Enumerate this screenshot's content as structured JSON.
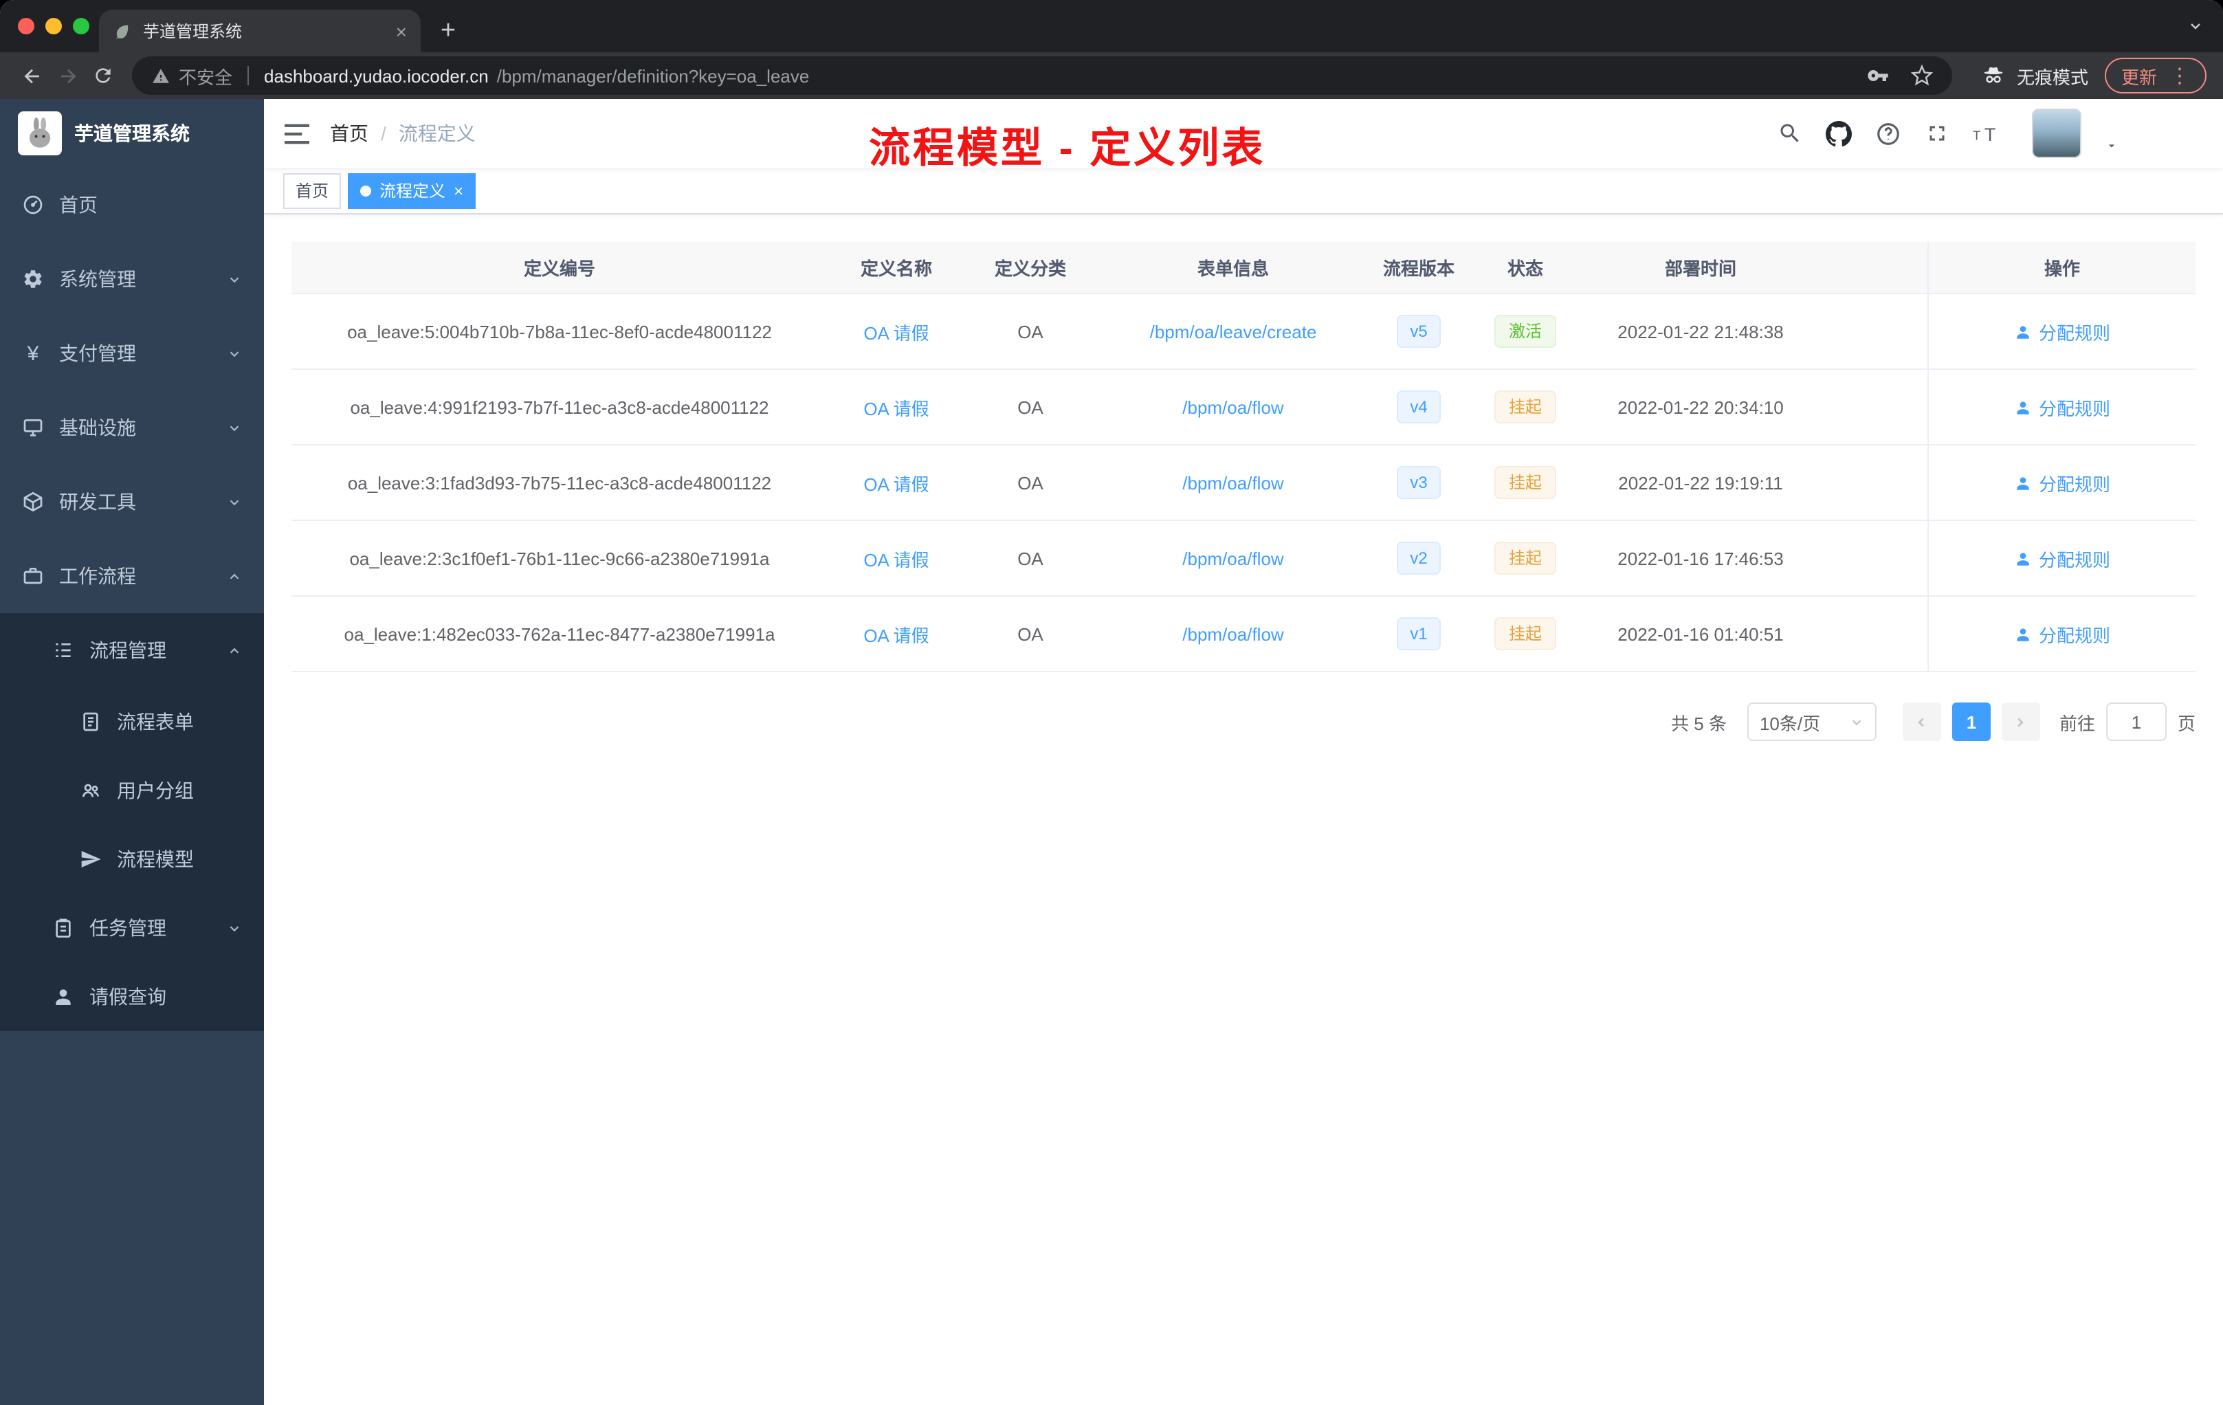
{
  "colors": {
    "accent_blue": "#409eff",
    "success_green": "#67c23a",
    "warning_orange": "#e6a23c",
    "sidebar_bg": "#304156",
    "submenu_bg": "#1f2d3d",
    "annotation_red": "#f21414",
    "chrome_dark": "#202124",
    "chrome_toolbar": "#35363a",
    "active_tag_bg": "#409eff"
  },
  "browser": {
    "tab_title": "芋道管理系统",
    "security_label": "不安全",
    "url_host": "dashboard.yudao.iocoder.cn",
    "url_path": "/bpm/manager/definition?key=oa_leave",
    "incognito_label": "无痕模式",
    "update_label": "更新"
  },
  "sidebar": {
    "logo_title": "芋道管理系统",
    "items": [
      {
        "label": "首页"
      },
      {
        "label": "系统管理"
      },
      {
        "label": "支付管理"
      },
      {
        "label": "基础设施"
      },
      {
        "label": "研发工具"
      },
      {
        "label": "工作流程"
      },
      {
        "label": "流程管理"
      },
      {
        "label": "流程表单"
      },
      {
        "label": "用户分组"
      },
      {
        "label": "流程模型"
      },
      {
        "label": "任务管理"
      },
      {
        "label": "请假查询"
      }
    ]
  },
  "header": {
    "breadcrumb_home": "首页",
    "breadcrumb_current": "流程定义",
    "annotation": "流程模型 - 定义列表"
  },
  "tags": {
    "home": "首页",
    "active": "流程定义"
  },
  "table": {
    "columns": [
      "定义编号",
      "定义名称",
      "定义分类",
      "表单信息",
      "流程版本",
      "状态",
      "部署时间",
      "操作"
    ],
    "rows": [
      {
        "id": "oa_leave:5:004b710b-7b8a-11ec-8ef0-acde48001122",
        "name": "OA 请假",
        "category": "OA",
        "form": "/bpm/oa/leave/create",
        "version": "v5",
        "status": "激活",
        "deploy_time": "2022-01-22 21:48:38",
        "action": "分配规则"
      },
      {
        "id": "oa_leave:4:991f2193-7b7f-11ec-a3c8-acde48001122",
        "name": "OA 请假",
        "category": "OA",
        "form": "/bpm/oa/flow",
        "version": "v4",
        "status": "挂起",
        "deploy_time": "2022-01-22 20:34:10",
        "action": "分配规则"
      },
      {
        "id": "oa_leave:3:1fad3d93-7b75-11ec-a3c8-acde48001122",
        "name": "OA 请假",
        "category": "OA",
        "form": "/bpm/oa/flow",
        "version": "v3",
        "status": "挂起",
        "deploy_time": "2022-01-22 19:19:11",
        "action": "分配规则"
      },
      {
        "id": "oa_leave:2:3c1f0ef1-76b1-11ec-9c66-a2380e71991a",
        "name": "OA 请假",
        "category": "OA",
        "form": "/bpm/oa/flow",
        "version": "v2",
        "status": "挂起",
        "deploy_time": "2022-01-16 17:46:53",
        "action": "分配规则"
      },
      {
        "id": "oa_leave:1:482ec033-762a-11ec-8477-a2380e71991a",
        "name": "OA 请假",
        "category": "OA",
        "form": "/bpm/oa/flow",
        "version": "v1",
        "status": "挂起",
        "deploy_time": "2022-01-16 01:40:51",
        "action": "分配规则"
      }
    ]
  },
  "pagination": {
    "total": "共 5 条",
    "page_size": "10条/页",
    "current_page": "1",
    "goto_label": "前往",
    "goto_value": "1",
    "page_unit": "页"
  }
}
